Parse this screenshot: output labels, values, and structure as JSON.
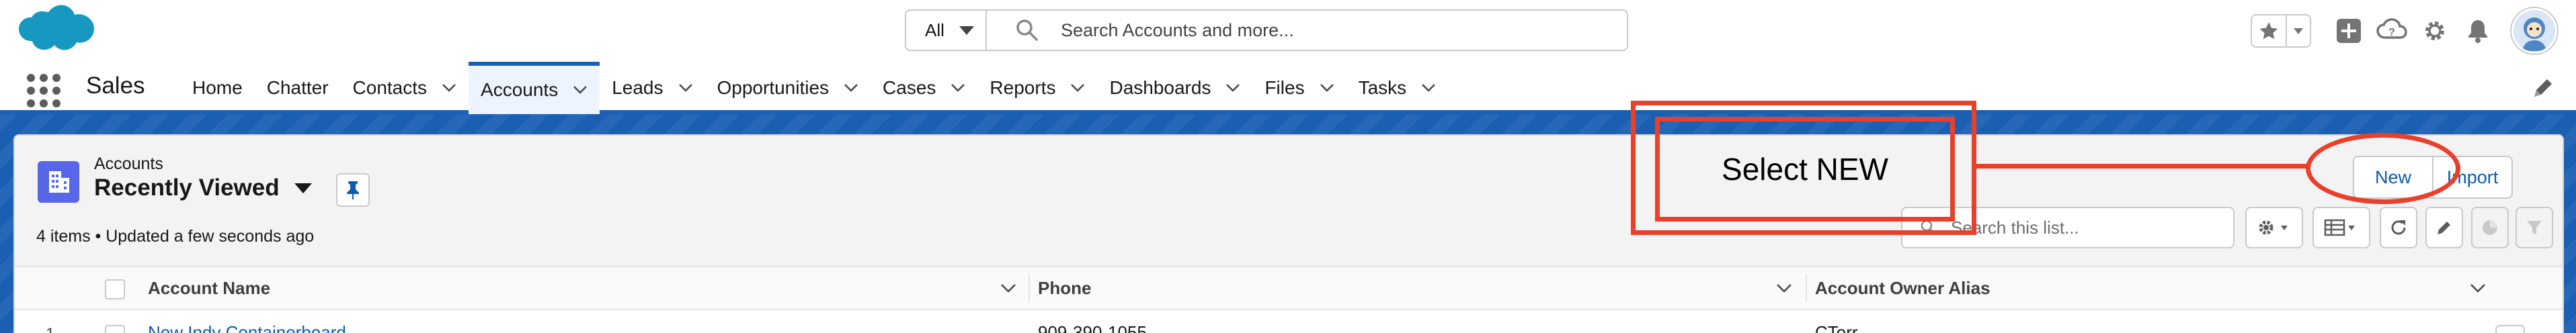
{
  "header": {
    "search_scope": "All",
    "search_placeholder": "Search Accounts and more..."
  },
  "nav": {
    "app_name": "Sales",
    "items": [
      {
        "label": "Home",
        "has_menu": false
      },
      {
        "label": "Chatter",
        "has_menu": false
      },
      {
        "label": "Contacts",
        "has_menu": true
      },
      {
        "label": "Accounts",
        "has_menu": true,
        "active": true
      },
      {
        "label": "Leads",
        "has_menu": true
      },
      {
        "label": "Opportunities",
        "has_menu": true
      },
      {
        "label": "Cases",
        "has_menu": true
      },
      {
        "label": "Reports",
        "has_menu": true
      },
      {
        "label": "Dashboards",
        "has_menu": true
      },
      {
        "label": "Files",
        "has_menu": true
      },
      {
        "label": "Tasks",
        "has_menu": true
      }
    ]
  },
  "list_view": {
    "object_label": "Accounts",
    "view_name": "Recently Viewed",
    "meta": "4 items • Updated a few seconds ago",
    "new_button": "New",
    "import_button": "Import",
    "search_placeholder": "Search this list..."
  },
  "table": {
    "columns": [
      "Account Name",
      "Phone",
      "Account Owner Alias"
    ],
    "rows": [
      {
        "num": "1",
        "account_name": "New Indy Containerboard",
        "phone": "909-390-1055",
        "owner_alias": "CTorr"
      }
    ]
  },
  "annotation": {
    "text": "Select NEW"
  },
  "colors": {
    "brand_blue": "#1b5fb3",
    "link_blue": "#0b5cab",
    "account_icon": "#5867e8",
    "annotation_red": "#e8402a"
  }
}
